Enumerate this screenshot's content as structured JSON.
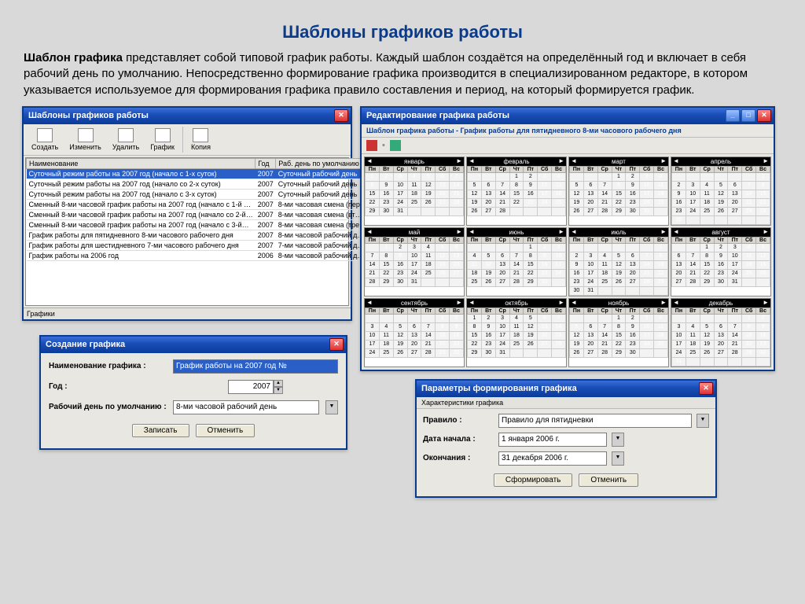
{
  "page": {
    "title": "Шаблоны графиков работы",
    "intro_bold": "Шаблон графика",
    "intro_rest": " представляет собой типовой график работы. Каждый шаблон создаётся на определённый год и включает в себя рабочий день по умолчанию. Непосредственно формирование графика производится в специализированном редакторе, в котором указывается используемое для формирования графика правило составления и период, на который формируется график."
  },
  "win_templates": {
    "title": "Шаблоны графиков работы",
    "toolbar": [
      "Создать",
      "Изменить",
      "Удалить",
      "График",
      "",
      "Копия"
    ],
    "columns": [
      "Наименование",
      "Год",
      "Раб. день по умолчанию"
    ],
    "rows": [
      {
        "name": "Суточный режим работы на 2007 год (начало с 1-х суток)",
        "year": "2007",
        "day": "Суточный рабочий день",
        "sel": true
      },
      {
        "name": "Суточный режим работы на 2007 год (начало со 2-х суток)",
        "year": "2007",
        "day": "Суточный рабочий день"
      },
      {
        "name": "Суточный режим работы на 2007 год (начало с 3-х суток)",
        "year": "2007",
        "day": "Суточный рабочий день"
      },
      {
        "name": "Сменный 8-ми часовой график работы на 2007 год (начало с 1-й …",
        "year": "2007",
        "day": "8-ми часовая смена (пер…"
      },
      {
        "name": "Сменный 8-ми часовой график работы на 2007 год (начало со 2-й…",
        "year": "2007",
        "day": "8-ми часовая смена (вт…"
      },
      {
        "name": "Сменный 8-ми часовой график работы на 2007 год (начало с 3-й…",
        "year": "2007",
        "day": "8-ми часовая смена (тре…"
      },
      {
        "name": "График работы для пятидневного 8-ми часового рабочего дня",
        "year": "2007",
        "day": "8-ми часовой рабочий д…"
      },
      {
        "name": "График работы для шестидневного 7-ми часового рабочего дня",
        "year": "2007",
        "day": "7-ми часовой рабочий д…"
      },
      {
        "name": "График работы на 2006 год",
        "year": "2006",
        "day": "8-ми часовой рабочий д…"
      }
    ],
    "footer": "Графики"
  },
  "win_create": {
    "title": "Создание графика",
    "label_name": "Наименование графика :",
    "value_name": "График работы на 2007 год №",
    "label_year": "Год :",
    "value_year": "2007",
    "label_day": "Рабочий день по умолчанию :",
    "value_day": "8-ми часовой рабочий день",
    "btn_save": "Записать",
    "btn_cancel": "Отменить"
  },
  "win_cal": {
    "title": "Редактирование графика работы",
    "subtitle": "Шаблон графика работы - График работы для пятидневного 8-ми часового рабочего дня",
    "weekdays": [
      "Пн",
      "Вт",
      "Ср",
      "Чт",
      "Пт",
      "Сб",
      "Вс"
    ],
    "months": [
      "январь",
      "февраль",
      "март",
      "апрель",
      "май",
      "июнь",
      "июль",
      "август",
      "сентябрь",
      "октябрь",
      "ноябрь",
      "декабрь"
    ]
  },
  "win_params": {
    "title": "Параметры формирования графика",
    "subtitle": "Характеристики графика",
    "label_rule": "Правило :",
    "value_rule": "Правило для пятидневки",
    "label_start": "Дата начала :",
    "value_start": "1  января  2006 г.",
    "label_end": "Окончания :",
    "value_end": "31 декабря  2006 г.",
    "btn_form": "Сформировать",
    "btn_cancel": "Отменить"
  }
}
